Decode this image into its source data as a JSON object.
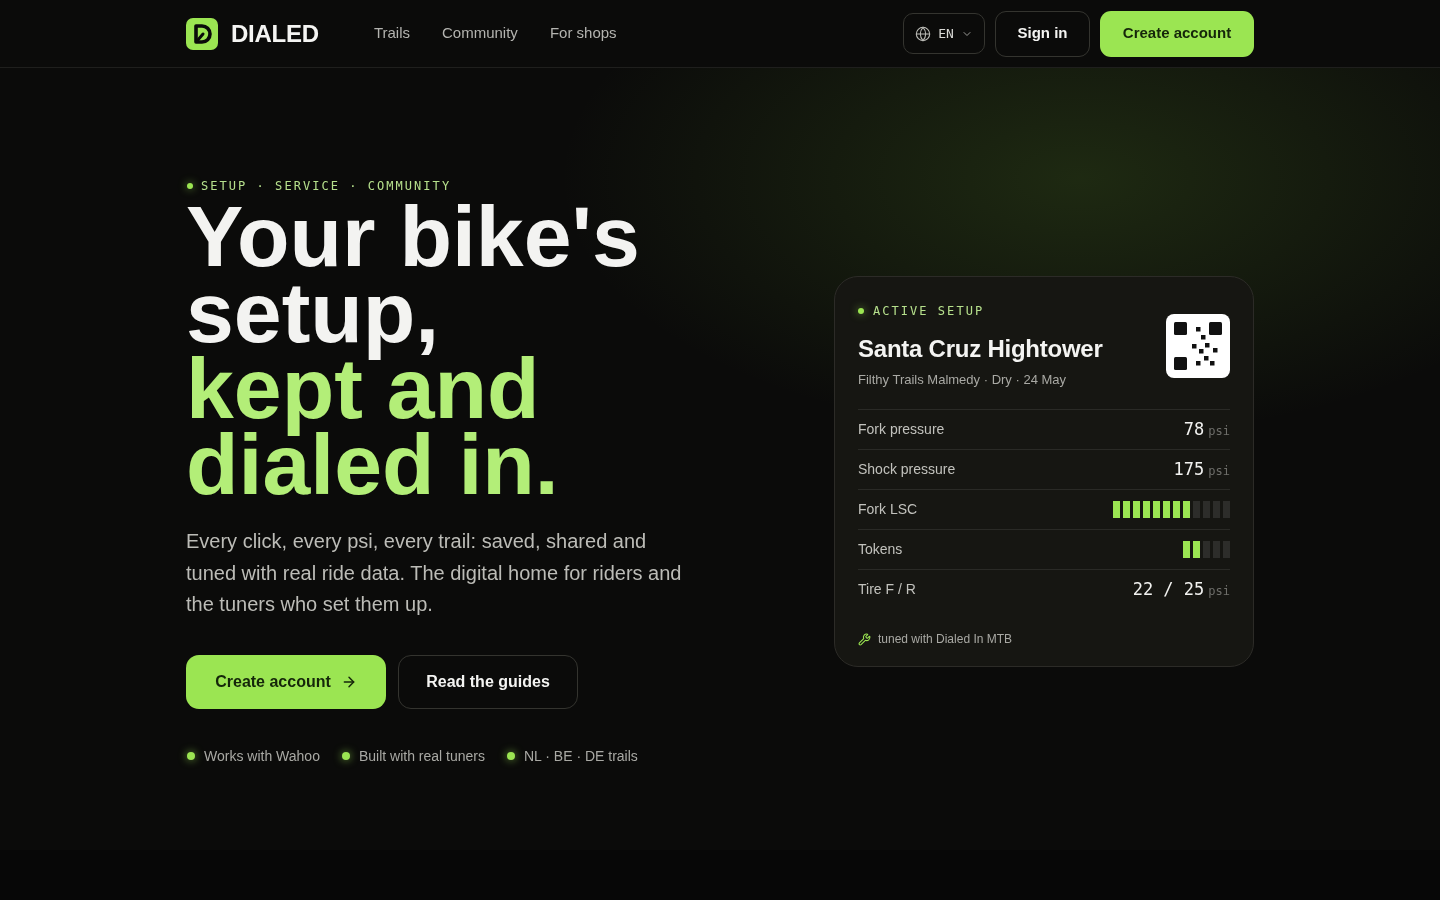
{
  "header": {
    "brand": "DIALED",
    "nav": [
      "Trails",
      "Community",
      "For shops"
    ],
    "language": "EN",
    "sign_in": "Sign in",
    "create_account": "Create account"
  },
  "hero": {
    "eyebrow": "SETUP · SERVICE · COMMUNITY",
    "headline": [
      {
        "text": "Your bike's setup,",
        "accent": false
      },
      {
        "text": "kept and dialed in.",
        "accent": true
      }
    ],
    "lead": "Every click, every psi, every trail: saved, shared and tuned with real ride data. The digital home for riders and the tuners who set them up.",
    "buttons": [
      {
        "label": "Create account",
        "kind": "primary"
      },
      {
        "label": "Read the guides",
        "kind": "secondary"
      }
    ],
    "highlights": [
      "Works with Wahoo",
      "Built with real tuners",
      "NL · BE · DE trails"
    ]
  },
  "setup_card": {
    "eyebrow": "ACTIVE SETUP",
    "title": "Santa Cruz Hightower",
    "subtitle": "Filthy Trails Malmedy · Dry · 24 May",
    "rows": [
      {
        "label": "Fork pressure",
        "kind": "reading",
        "value": "78",
        "unit": "psi"
      },
      {
        "label": "Shock pressure",
        "kind": "reading",
        "value": "175",
        "unit": "psi"
      },
      {
        "label": "Fork LSC",
        "kind": "clicks",
        "level": 0.6667
      },
      {
        "label": "Tokens",
        "kind": "tokens",
        "level": 0.4
      },
      {
        "label": "Tire F / R",
        "kind": "reading",
        "value": "22 / 25",
        "unit": "psi"
      }
    ],
    "footer": "tuned with Dialed In MTB"
  }
}
